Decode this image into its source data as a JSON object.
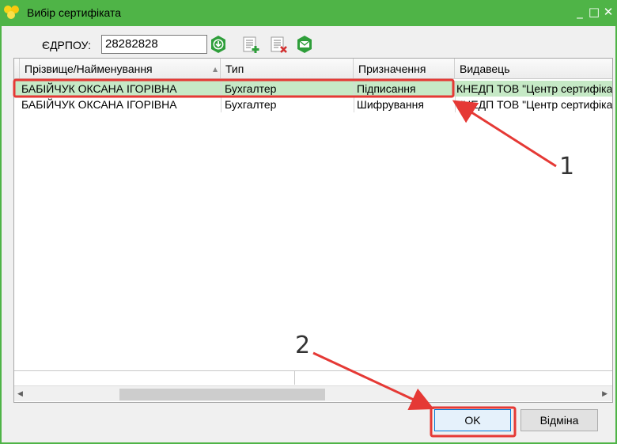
{
  "window": {
    "title": "Вибір сертифіката",
    "controls": {
      "minimize": "_",
      "maximize": "□",
      "close": "✕"
    }
  },
  "toolbar": {
    "edrpou_label": "ЄДРПОУ:",
    "edrpou_value": "28282828",
    "icons": [
      "download-icon",
      "add-certificate-icon",
      "remove-certificate-icon",
      "mail-icon"
    ]
  },
  "grid": {
    "columns": [
      "Прізвище/Найменування",
      "Тип",
      "Призначення",
      "Видавець"
    ],
    "rows": [
      {
        "name": "БАБІЙЧУК ОКСАНА ІГОРІВНА",
        "type": "Бухгалтер",
        "purpose": "Підписання",
        "issuer": "КНЕДП ТОВ \"Центр сертифікації ключів \"Україна\"",
        "selected": true
      },
      {
        "name": "БАБІЙЧУК ОКСАНА ІГОРІВНА",
        "type": "Бухгалтер",
        "purpose": "Шифрування",
        "issuer": "КНЕДП ТОВ \"Центр сертифікації ключів \"Україна\"",
        "selected": false
      }
    ]
  },
  "buttons": {
    "ok": "OK",
    "cancel": "Відміна"
  },
  "annotations": {
    "marker_1": "1",
    "marker_2": "2",
    "color": "#e53935"
  },
  "colors": {
    "title_bar": "#4fb447",
    "selected_row": "#c6e9c6",
    "annotation_red": "#e53935"
  }
}
